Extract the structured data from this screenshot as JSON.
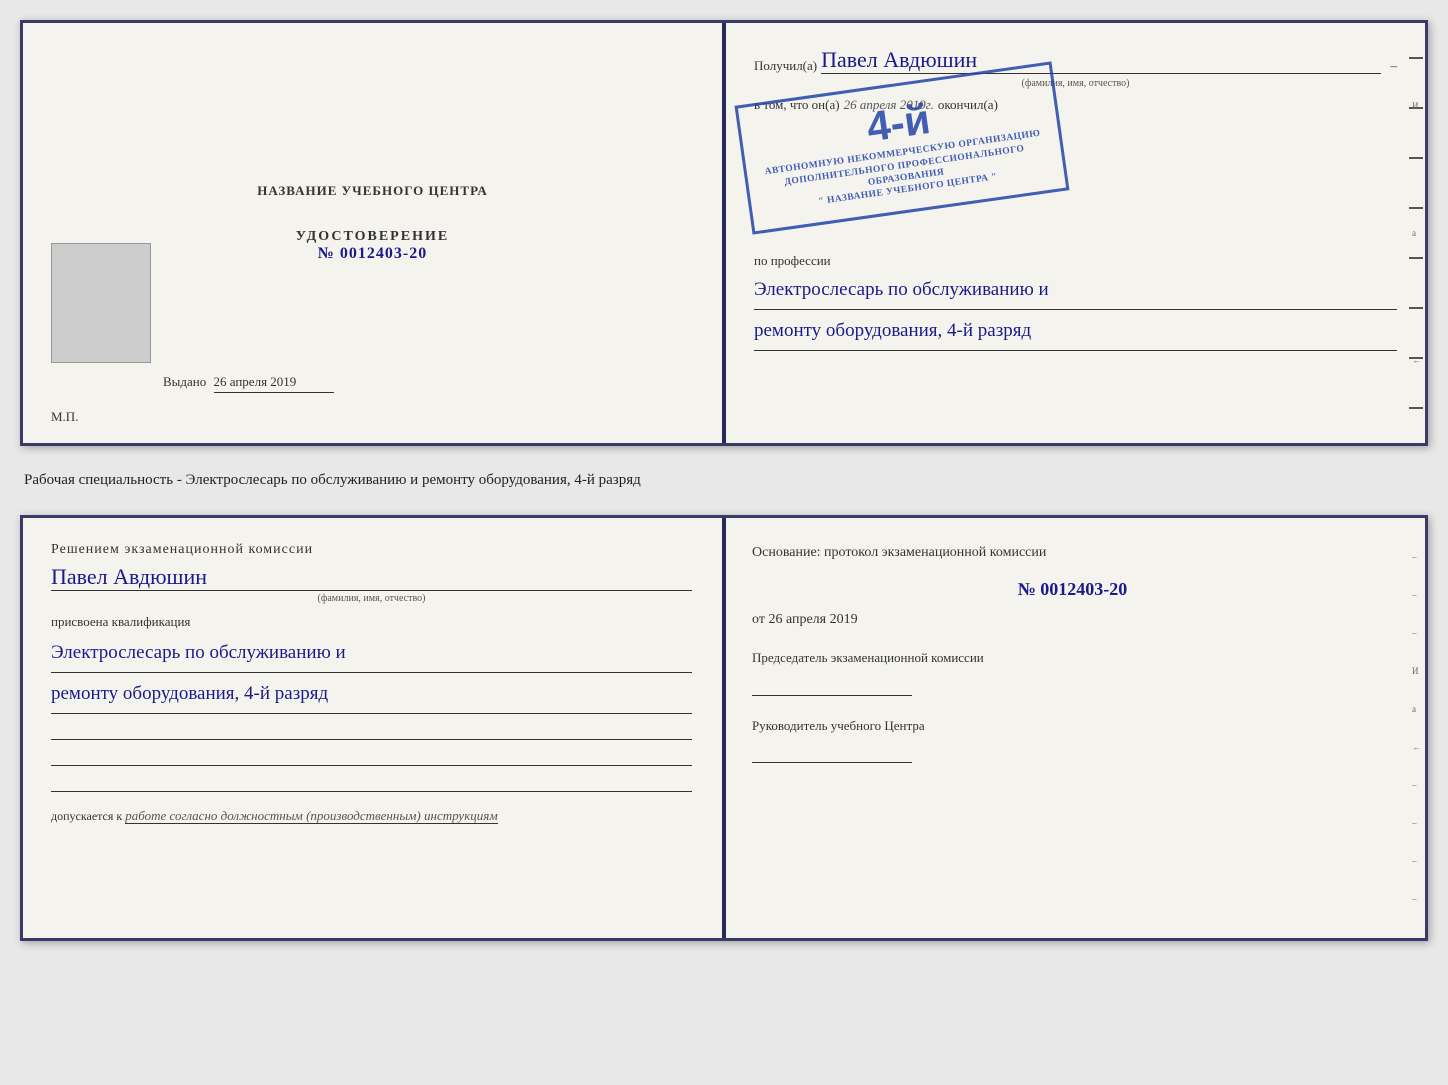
{
  "top_doc": {
    "left": {
      "title": "НАЗВАНИЕ УЧЕБНОГО ЦЕНТРА",
      "udost_label": "УДОСТОВЕРЕНИЕ",
      "udost_number": "№ 0012403-20",
      "vydano_label": "Выдано",
      "vydano_date": "26 апреля 2019",
      "mp_label": "М.П."
    },
    "right": {
      "poluchil_prefix": "Получил(a)",
      "name_handwritten": "Павел Авдюшин",
      "fio_label": "(фамилия, имя, отчество)",
      "vtom_prefix": "в том, что он(a)",
      "date_handwritten": "26 апреля 2019г.",
      "okonchil": "окончил(a)",
      "stamp_number": "4-й",
      "stamp_line1": "АВТОНОМНУЮ НЕКОММЕРЧЕСКУЮ ОРГАНИЗАЦИЮ",
      "stamp_line2": "ДОПОЛНИТЕЛЬНОГО ПРОФЕССИОНАЛЬНОГО ОБРАЗОВАНИЯ",
      "stamp_line3": "\" НАЗВАНИЕ УЧЕБНОГО ЦЕНТРА \"",
      "po_professii": "по профессии",
      "profession_line1": "Электрослесарь по обслуживанию и",
      "profession_line2": "ремонту оборудования, 4-й разряд"
    }
  },
  "specialty_text": "Рабочая специальность - Электрослесарь по обслуживанию и ремонту оборудования, 4-й разряд",
  "bottom_doc": {
    "left": {
      "resheniem_title": "Решением экзаменационной комиссии",
      "name_handwritten": "Павел Авдюшин",
      "fio_label": "(фамилия, имя, отчество)",
      "prisvoena": "присвоена квалификация",
      "qualification_line1": "Электрослесарь по обслуживанию и",
      "qualification_line2": "ремонту оборудования, 4-й разряд",
      "dopuskaetsya": "допускается к",
      "dopusk_italic": "работе согласно должностным (производственным) инструкциям"
    },
    "right": {
      "osnovanie": "Основание: протокол экзаменационной комиссии",
      "number": "№ 0012403-20",
      "ot_label": "от",
      "ot_date": "26 апреля 2019",
      "predsedatel_label": "Председатель экзаменационной комиссии",
      "rukovoditel_label": "Руководитель учебного Центра"
    }
  }
}
